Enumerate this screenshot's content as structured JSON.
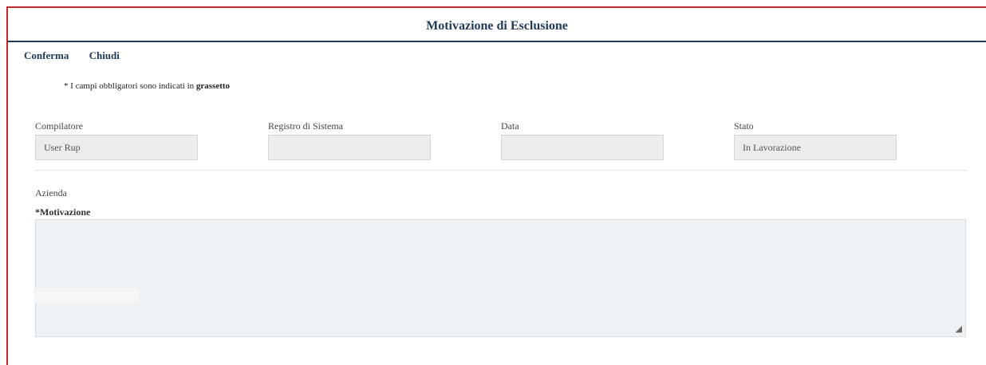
{
  "title": "Motivazione di Esclusione",
  "toolbar": {
    "confirm": "Conferma",
    "close": "Chiudi"
  },
  "note": {
    "text": "* I campi obbligatori sono indicati in",
    "bold": "grassetto"
  },
  "fields": {
    "compilatore": {
      "label": "Compilatore",
      "value": "User Rup"
    },
    "registro": {
      "label": "Registro di Sistema",
      "value": ""
    },
    "data": {
      "label": "Data",
      "value": ""
    },
    "stato": {
      "label": "Stato",
      "value": "In Lavorazione"
    }
  },
  "azienda": {
    "label": "Azienda"
  },
  "motivazione": {
    "label": "*Motivazione",
    "value": ""
  },
  "colors": {
    "frame": "#c0282d",
    "primary": "#1f3a5a",
    "input_bg": "#ececec",
    "textarea_bg": "#eef2f4"
  },
  "icons": {
    "resize": "resize-handle-icon"
  }
}
